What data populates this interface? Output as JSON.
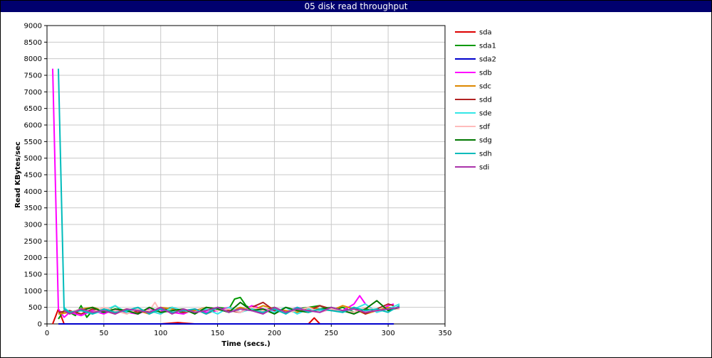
{
  "chart_data": {
    "type": "line",
    "title": "05 disk read throughput",
    "xlabel": "Time (secs.)",
    "ylabel": "Read KBytes/sec",
    "xlim": [
      0,
      350
    ],
    "ylim": [
      0,
      9000
    ],
    "x_ticks": [
      "0",
      "50",
      "100",
      "150",
      "200",
      "250",
      "300",
      "350"
    ],
    "y_ticks": [
      "0",
      "500",
      "1000",
      "1500",
      "2000",
      "2500",
      "3000",
      "3500",
      "4000",
      "4500",
      "5000",
      "5500",
      "6000",
      "6500",
      "7000",
      "7500",
      "8000",
      "8500",
      "9000"
    ],
    "grid": true,
    "legend_position": "right",
    "series": [
      {
        "name": "sda",
        "color": "#dd0000",
        "x": [
          5,
          10,
          15,
          30,
          50,
          100,
          115,
          130,
          150,
          200,
          230,
          235,
          240,
          260,
          280,
          300,
          305
        ],
        "y": [
          0,
          450,
          0,
          0,
          0,
          0,
          40,
          0,
          0,
          0,
          0,
          180,
          0,
          0,
          0,
          0,
          0
        ]
      },
      {
        "name": "sda1",
        "color": "#009900",
        "x": [
          10,
          15,
          20,
          25,
          30,
          35,
          40,
          50,
          60,
          70,
          80,
          90,
          100,
          110,
          120,
          130,
          140,
          150,
          160,
          165,
          170,
          175,
          180,
          190,
          200,
          210,
          220,
          230,
          240,
          250,
          260,
          270,
          280,
          290,
          300,
          305
        ],
        "y": [
          150,
          400,
          350,
          250,
          550,
          200,
          400,
          350,
          550,
          300,
          450,
          350,
          400,
          500,
          300,
          450,
          300,
          500,
          450,
          750,
          800,
          550,
          450,
          400,
          500,
          350,
          450,
          500,
          550,
          400,
          500,
          350,
          450,
          400,
          500,
          480
        ]
      },
      {
        "name": "sda2",
        "color": "#0000cc",
        "x": [
          10,
          50,
          100,
          150,
          200,
          250,
          300,
          305
        ],
        "y": [
          0,
          0,
          0,
          0,
          0,
          0,
          0,
          0
        ]
      },
      {
        "name": "sdb",
        "color": "#ff00ff",
        "x": [
          5,
          10,
          15,
          20,
          30,
          40,
          50,
          60,
          70,
          80,
          90,
          100,
          110,
          120,
          130,
          140,
          150,
          160,
          170,
          180,
          190,
          200,
          210,
          220,
          230,
          240,
          250,
          260,
          265,
          270,
          275,
          280,
          290,
          300,
          305
        ],
        "y": [
          7700,
          450,
          200,
          350,
          250,
          400,
          300,
          450,
          350,
          300,
          450,
          400,
          350,
          300,
          450,
          350,
          400,
          500,
          350,
          550,
          450,
          400,
          350,
          500,
          400,
          350,
          450,
          400,
          500,
          600,
          850,
          600,
          350,
          550,
          600
        ]
      },
      {
        "name": "sdc",
        "color": "#dd8800",
        "x": [
          10,
          20,
          30,
          40,
          50,
          60,
          70,
          80,
          90,
          100,
          110,
          120,
          130,
          140,
          150,
          160,
          170,
          180,
          190,
          200,
          210,
          220,
          230,
          240,
          250,
          260,
          270,
          280,
          290,
          300,
          305
        ],
        "y": [
          300,
          350,
          450,
          500,
          400,
          350,
          450,
          400,
          300,
          500,
          450,
          350,
          400,
          500,
          450,
          350,
          500,
          400,
          550,
          450,
          400,
          350,
          500,
          450,
          400,
          550,
          450,
          300,
          400,
          500,
          450
        ]
      },
      {
        "name": "sdd",
        "color": "#b22222",
        "x": [
          10,
          20,
          30,
          40,
          50,
          60,
          70,
          80,
          90,
          100,
          110,
          120,
          130,
          140,
          150,
          160,
          170,
          180,
          190,
          200,
          210,
          220,
          230,
          240,
          250,
          260,
          270,
          280,
          290,
          300,
          305
        ],
        "y": [
          350,
          400,
          300,
          450,
          400,
          300,
          450,
          350,
          400,
          300,
          500,
          350,
          450,
          300,
          450,
          400,
          350,
          500,
          650,
          400,
          350,
          450,
          400,
          550,
          450,
          350,
          500,
          300,
          450,
          600,
          550
        ]
      },
      {
        "name": "sde",
        "color": "#33e6e6",
        "x": [
          15,
          20,
          30,
          40,
          50,
          60,
          70,
          80,
          90,
          100,
          110,
          120,
          130,
          140,
          150,
          160,
          170,
          180,
          190,
          200,
          210,
          220,
          230,
          240,
          250,
          260,
          270,
          280,
          290,
          300,
          310
        ],
        "y": [
          500,
          350,
          450,
          300,
          400,
          550,
          350,
          450,
          400,
          300,
          500,
          400,
          350,
          450,
          300,
          500,
          350,
          450,
          400,
          350,
          500,
          300,
          450,
          400,
          500,
          350,
          450,
          600,
          350,
          450,
          600
        ]
      },
      {
        "name": "sdf",
        "color": "#ffbbbb",
        "x": [
          15,
          20,
          30,
          40,
          50,
          60,
          70,
          80,
          90,
          95,
          100,
          110,
          120,
          130,
          140,
          150,
          160,
          170,
          180,
          190,
          200,
          210,
          220,
          230,
          240,
          250,
          260,
          270,
          280,
          290,
          300,
          310
        ],
        "y": [
          400,
          350,
          450,
          350,
          500,
          400,
          300,
          450,
          400,
          650,
          350,
          400,
          450,
          350,
          500,
          400,
          450,
          350,
          500,
          400,
          450,
          350,
          400,
          500,
          350,
          450,
          400,
          350,
          500,
          400,
          450,
          450
        ]
      },
      {
        "name": "sdg",
        "color": "#007700",
        "x": [
          15,
          20,
          30,
          40,
          50,
          60,
          70,
          80,
          90,
          100,
          110,
          120,
          130,
          140,
          150,
          160,
          170,
          180,
          190,
          200,
          210,
          220,
          230,
          240,
          250,
          260,
          270,
          280,
          290,
          300,
          310
        ],
        "y": [
          450,
          350,
          400,
          500,
          350,
          450,
          400,
          300,
          500,
          350,
          400,
          450,
          300,
          500,
          450,
          350,
          650,
          400,
          450,
          300,
          500,
          400,
          350,
          450,
          500,
          400,
          300,
          450,
          700,
          400,
          500
        ]
      },
      {
        "name": "sdh",
        "color": "#00bbbb",
        "x": [
          10,
          15,
          20,
          30,
          40,
          50,
          60,
          70,
          80,
          90,
          100,
          110,
          120,
          130,
          140,
          150,
          160,
          170,
          180,
          190,
          200,
          210,
          220,
          230,
          240,
          250,
          260,
          270,
          280,
          290,
          300,
          310
        ],
        "y": [
          7700,
          450,
          350,
          400,
          300,
          450,
          350,
          400,
          500,
          300,
          450,
          350,
          400,
          450,
          300,
          500,
          350,
          450,
          400,
          350,
          450,
          300,
          500,
          350,
          450,
          400,
          350,
          500,
          400,
          450,
          350,
          550
        ]
      },
      {
        "name": "sdi",
        "color": "#aa33aa",
        "x": [
          15,
          20,
          30,
          40,
          50,
          60,
          70,
          80,
          90,
          100,
          110,
          120,
          130,
          140,
          150,
          160,
          170,
          180,
          190,
          200,
          210,
          220,
          230,
          240,
          250,
          260,
          270,
          280,
          290,
          300,
          310
        ],
        "y": [
          400,
          300,
          450,
          350,
          400,
          300,
          450,
          400,
          350,
          500,
          300,
          450,
          350,
          400,
          500,
          350,
          450,
          400,
          300,
          500,
          350,
          450,
          400,
          350,
          500,
          400,
          450,
          350,
          400,
          450,
          500
        ]
      }
    ]
  }
}
